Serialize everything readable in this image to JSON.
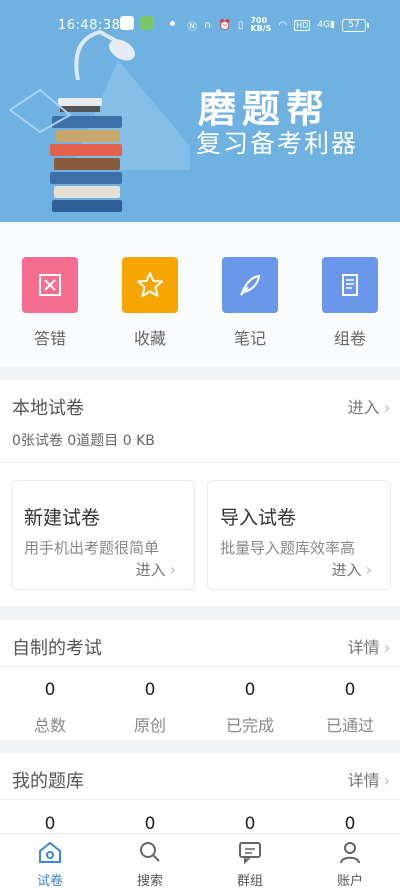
{
  "status_bar": {
    "time": "16:48:38",
    "net_speed": "700\nKB/S",
    "battery": "57",
    "signal": "4G"
  },
  "banner": {
    "title": "磨题帮",
    "subtitle": "复习备考利器"
  },
  "quick_actions": [
    {
      "label": "答错",
      "color": "#f56e8f",
      "icon": "wrong-answers-icon"
    },
    {
      "label": "收藏",
      "color": "#f7a500",
      "icon": "star-icon"
    },
    {
      "label": "笔记",
      "color": "#6a97ea",
      "icon": "feather-pen-icon"
    },
    {
      "label": "组卷",
      "color": "#6a97ea",
      "icon": "scroll-icon"
    }
  ],
  "local_papers": {
    "title": "本地试卷",
    "enter": "进入",
    "stats": "0张试卷 0道题目 0 KB",
    "new_paper": {
      "title": "新建试卷",
      "desc": "用手机出考题很简单",
      "enter": "进入"
    },
    "import_paper": {
      "title": "导入试卷",
      "desc": "批量导入题库效率高",
      "enter": "进入"
    }
  },
  "my_exams": {
    "title": "自制的考试",
    "details": "详情",
    "stats": [
      {
        "value": "0",
        "label": "总数"
      },
      {
        "value": "0",
        "label": "原创"
      },
      {
        "value": "0",
        "label": "已完成"
      },
      {
        "value": "0",
        "label": "已通过"
      }
    ]
  },
  "my_bank": {
    "title": "我的题库",
    "details": "详情",
    "stats": [
      {
        "value": "0"
      },
      {
        "value": "0"
      },
      {
        "value": "0"
      },
      {
        "value": "0"
      }
    ]
  },
  "bottom_nav": [
    {
      "label": "试卷",
      "icon": "home-icon",
      "active": true
    },
    {
      "label": "搜索",
      "icon": "search-icon",
      "active": false
    },
    {
      "label": "群组",
      "icon": "chat-icon",
      "active": false
    },
    {
      "label": "账户",
      "icon": "user-icon",
      "active": false
    }
  ]
}
